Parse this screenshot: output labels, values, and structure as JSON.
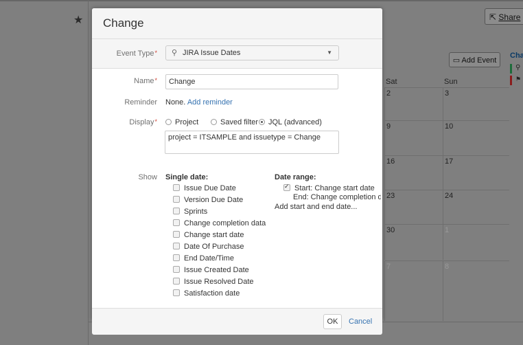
{
  "background": {
    "share_label": "Share",
    "add_event_label": "Add Event",
    "side_title": "Cha",
    "calendar": {
      "headers": [
        "Sat",
        "Sun"
      ],
      "rows": [
        [
          "2",
          "3"
        ],
        [
          "9",
          "10"
        ],
        [
          "16",
          "17"
        ],
        [
          "23",
          "24"
        ],
        [
          "30",
          "1"
        ],
        [
          "7",
          "8"
        ]
      ]
    }
  },
  "dialog": {
    "title": "Change",
    "event_type": {
      "label": "Event Type",
      "value": "JIRA Issue Dates"
    },
    "name": {
      "label": "Name",
      "value": "Change"
    },
    "reminder": {
      "label": "Reminder",
      "value": "None.",
      "link": "Add reminder"
    },
    "display": {
      "label": "Display",
      "options": [
        "Project",
        "Saved filter",
        "JQL (advanced)"
      ],
      "selected": "JQL (advanced)",
      "jql": "project = ITSAMPLE and issuetype = Change"
    },
    "show": {
      "label": "Show",
      "single_date_heading": "Single date:",
      "single_dates": [
        "Issue Due Date",
        "Version Due Date",
        "Sprints",
        "Change completion data",
        "Change start date",
        "Date Of Purchase",
        "End Date/Time",
        "Issue Created Date",
        "Issue Resolved Date",
        "Satisfaction date"
      ],
      "date_range_heading": "Date range:",
      "range_start": "Start: Change start date",
      "range_end": "End: Change completion data",
      "add_range_link": "Add start and end date..."
    },
    "ok_label": "OK",
    "cancel_label": "Cancel"
  },
  "colors": {
    "link": "#3572b0",
    "required": "#d04437",
    "overlay": "#7f7f7f"
  }
}
